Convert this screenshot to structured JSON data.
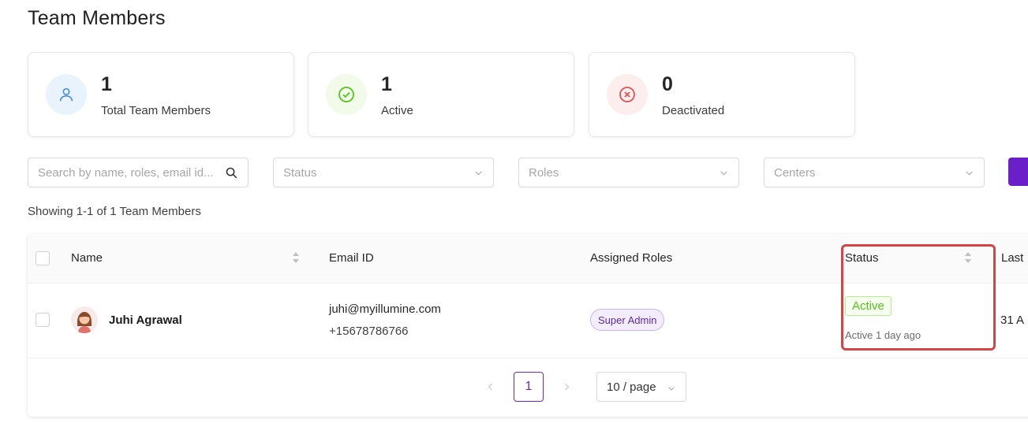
{
  "page": {
    "title": "Team Members"
  },
  "stats": [
    {
      "value": "1",
      "label": "Total Team Members",
      "icon": "user-icon",
      "color": "#4a90d9",
      "bg": "#e8f3fc"
    },
    {
      "value": "1",
      "label": "Active",
      "icon": "check-circle-icon",
      "color": "#52c41a",
      "bg": "#f2fbe9"
    },
    {
      "value": "0",
      "label": "Deactivated",
      "icon": "close-circle-icon",
      "color": "#e05252",
      "bg": "#fdeeee"
    }
  ],
  "filters": {
    "search_placeholder": "Search by name, roles, email id...",
    "status_placeholder": "Status",
    "roles_placeholder": "Roles",
    "centers_placeholder": "Centers"
  },
  "summary": "Showing 1-1 of 1 Team Members",
  "table": {
    "columns": [
      "Name",
      "Email ID",
      "Assigned Roles",
      "Status",
      "Last"
    ],
    "rows": [
      {
        "name": "Juhi Agrawal",
        "email": "juhi@myillumine.com",
        "phone": "+15678786766",
        "role": "Super Admin",
        "status": "Active",
        "status_detail": "Active 1 day ago",
        "last": "31 A"
      }
    ]
  },
  "pagination": {
    "current_page": "1",
    "page_size": "10 / page"
  },
  "colors": {
    "accent": "#6a2bb0",
    "primary_button": "#6a1fc9",
    "highlight": "#d64545"
  }
}
